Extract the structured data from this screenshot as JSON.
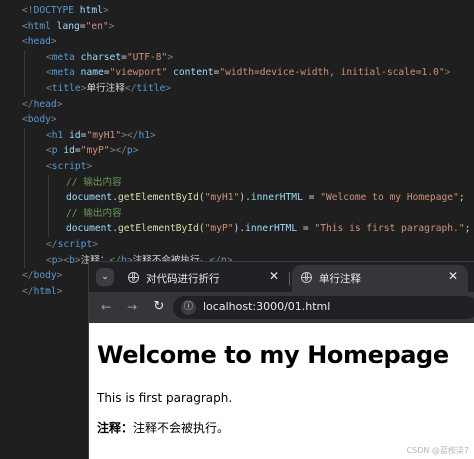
{
  "editor": {
    "line1": {
      "open": "<!",
      "name": "DOCTYPE",
      "attr": " html",
      "close": ">"
    },
    "line2": {
      "open": "<",
      "tag": "html",
      "attr": " lang",
      "eq": "=",
      "val": "\"en\"",
      "close": ">"
    },
    "line3": {
      "open": "<",
      "tag": "head",
      "close": ">"
    },
    "line4": {
      "open": "<",
      "tag": "meta",
      "attr": " charset",
      "eq": "=",
      "val": "\"UTF-8\"",
      "close": ">"
    },
    "line5": {
      "open": "<",
      "tag": "meta",
      "attr1": " name",
      "eq1": "=",
      "val1": "\"viewport\"",
      "attr2": " content",
      "eq2": "=",
      "val2": "\"width=device-width, initial-scale=1.0\"",
      "close": ">"
    },
    "line6": {
      "open": "<",
      "tag": "title",
      "close": ">",
      "text": "单行注释",
      "eopen": "</",
      "etag": "title",
      "eclose": ">"
    },
    "line7": {
      "open": "</",
      "tag": "head",
      "close": ">"
    },
    "line8": {
      "open": "<",
      "tag": "body",
      "close": ">"
    },
    "line9": {
      "open": "<",
      "tag": "h1",
      "attr": " id",
      "eq": "=",
      "val": "\"myH1\"",
      "close": ">",
      "eopen": "</",
      "etag": "h1",
      "eclose": ">"
    },
    "line10": {
      "open": "<",
      "tag": "p",
      "attr": " id",
      "eq": "=",
      "val": "\"myP\"",
      "close": ">",
      "eopen": "</",
      "etag": "p",
      "eclose": ">"
    },
    "line11": {
      "open": "<",
      "tag": "script",
      "close": ">"
    },
    "line12": {
      "comment": "// 输出内容"
    },
    "line13": {
      "obj": "document",
      "dot1": ".",
      "fn": "getElementById",
      "p1": "(",
      "arg": "\"myH1\"",
      "p2": ")",
      "dot2": ".",
      "prop": "innerHTML",
      "eq": " = ",
      "val": "\"Welcome to my Homepage\"",
      "semi": ";"
    },
    "line14": {
      "comment": "// 输出内容"
    },
    "line15": {
      "obj": "document",
      "dot1": ".",
      "fn": "getElementById",
      "p1": "(",
      "arg": "\"myP\"",
      "p2": ")",
      "dot2": ".",
      "prop": "innerHTML",
      "eq": " = ",
      "val": "\"This is first paragraph.\"",
      "semi": ";"
    },
    "line16": {
      "open": "</",
      "tag": "script",
      "close": ">"
    },
    "line17": {
      "o1": "<",
      "t1": "p",
      "c1": ">",
      "o2": "<",
      "t2": "b",
      "c2": ">",
      "text1": "注释：",
      "o3": "</",
      "t3": "b",
      "c3": ">",
      "text2": "注释不会被执行。",
      "o4": "</",
      "t4": "p",
      "c4": ">"
    },
    "line18": {
      "open": "</",
      "tag": "body",
      "close": ">"
    },
    "line19": {
      "open": "</",
      "tag": "html",
      "close": ">"
    }
  },
  "browser": {
    "tabs": [
      {
        "title": "对代码进行折行",
        "close": "✕"
      },
      {
        "title": "单行注释",
        "close": "✕"
      }
    ],
    "url": "localhost:3000/01.html",
    "page": {
      "h1": "Welcome to my Homepage",
      "p1": "This is first paragraph.",
      "p2_bold": "注释：",
      "p2_text": "注释不会被执行。"
    }
  },
  "watermark": "CSDN @蓝桉柒7",
  "icons": {
    "tab_search": "chevron-down-icon",
    "tab_favicon": "globe-icon",
    "back": "arrow-left-icon",
    "forward": "arrow-right-icon",
    "reload": "reload-icon",
    "site_info": "site-info-icon"
  },
  "colors": {
    "editor_bg": "#1f1f1f",
    "tag": "#569cd6",
    "attribute": "#9cdcfe",
    "string": "#ce9178",
    "comment": "#6a9955",
    "function": "#dcdcaa",
    "punctuation": "#808080",
    "browser_tabstrip": "#202124",
    "browser_toolbar": "#35363a"
  }
}
